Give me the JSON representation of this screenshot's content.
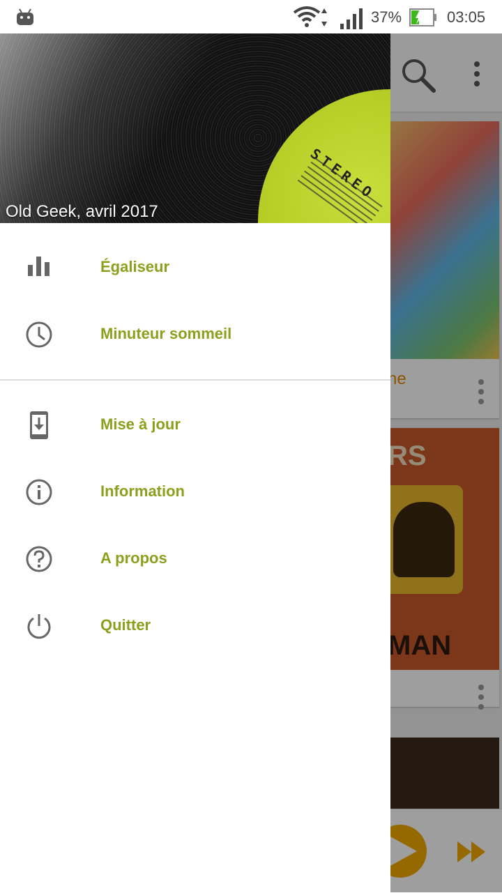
{
  "status_bar": {
    "battery_percent": "37%",
    "time": "03:05",
    "icons": [
      "android-icon",
      "wifi-icon",
      "signal-icon",
      "battery-charging-icon"
    ]
  },
  "drawer": {
    "header_caption": "Old Geek, avril 2017",
    "record_label_text": "STEREO",
    "sections": [
      {
        "items": [
          {
            "label": "Égaliseur",
            "icon": "equalizer-icon"
          },
          {
            "label": "Minuteur sommeil",
            "icon": "clock-icon"
          }
        ]
      },
      {
        "items": [
          {
            "label": "Mise à jour",
            "icon": "update-download-icon"
          },
          {
            "label": "Information",
            "icon": "info-icon"
          },
          {
            "label": "A propos",
            "icon": "help-icon"
          },
          {
            "label": "Quitter",
            "icon": "power-icon"
          }
        ]
      }
    ]
  },
  "background": {
    "cards": [
      {
        "title_fragment": "ne"
      },
      {
        "title_fragment_top": "RS",
        "title_fragment_bottom": "MAN"
      }
    ],
    "accent_color": "#f2a800"
  },
  "colors": {
    "menu_label": "#8aa11d",
    "icon_grey": "#666666"
  }
}
